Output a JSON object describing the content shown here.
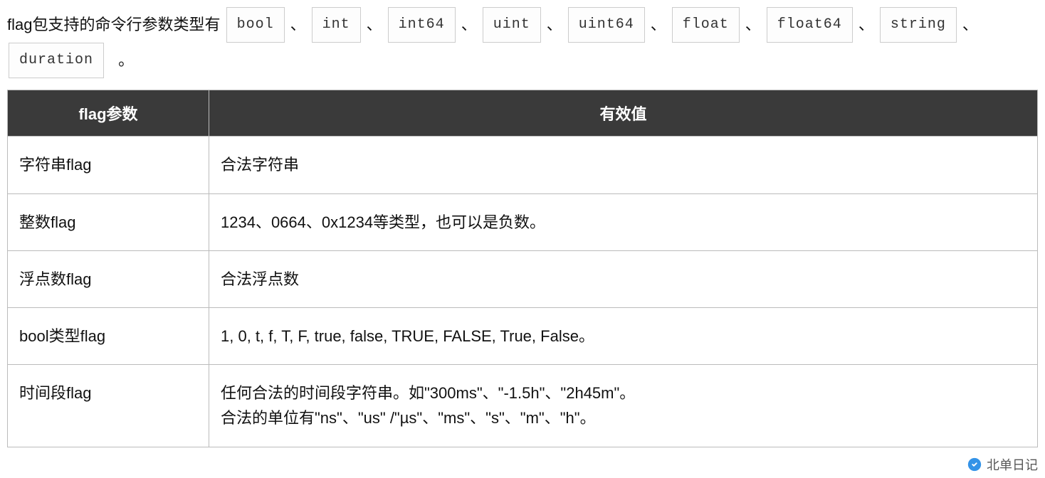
{
  "intro": {
    "prefix": "flag包支持的命令行参数类型有",
    "types": [
      "bool",
      "int",
      "int64",
      "uint",
      "uint64",
      "float",
      "float64",
      "string",
      "duration"
    ],
    "sep": "、",
    "suffix": "。"
  },
  "table": {
    "headers": [
      "flag参数",
      "有效值"
    ],
    "rows": [
      {
        "c1": "字符串flag",
        "c2": "合法字符串"
      },
      {
        "c1": "整数flag",
        "c2": "1234、0664、0x1234等类型，也可以是负数。"
      },
      {
        "c1": "浮点数flag",
        "c2": "合法浮点数"
      },
      {
        "c1": "bool类型flag",
        "c2": "1, 0, t, f, T, F, true, false, TRUE, FALSE, True, False。"
      },
      {
        "c1": "时间段flag",
        "c2": "任何合法的时间段字符串。如\"300ms\"、\"-1.5h\"、\"2h45m\"。\n合法的单位有\"ns\"、\"us\" /\"µs\"、\"ms\"、\"s\"、\"m\"、\"h\"。"
      }
    ]
  },
  "watermark": {
    "text": "北单日记"
  }
}
